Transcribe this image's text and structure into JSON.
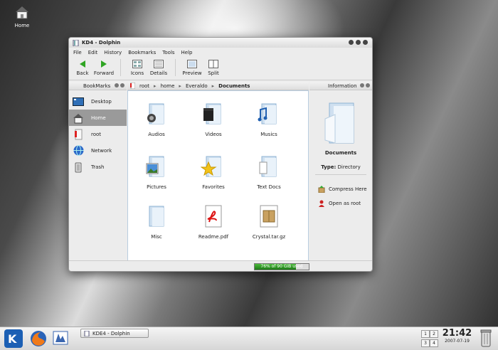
{
  "desktop": {
    "home_label": "Home"
  },
  "window": {
    "title": "KD4 - Dolphin",
    "menu": [
      "File",
      "Edit",
      "History",
      "Bookmarks",
      "Tools",
      "Help"
    ],
    "toolbar": {
      "back": "Back",
      "forward": "Forward",
      "icons": "Icons",
      "details": "Details",
      "preview": "Preview",
      "split": "Split"
    },
    "bookmarks": {
      "title": "BookMarks",
      "items": [
        {
          "label": "Desktop",
          "icon": "desktop-icon"
        },
        {
          "label": "Home",
          "icon": "home-icon",
          "selected": true
        },
        {
          "label": "root",
          "icon": "root-icon"
        },
        {
          "label": "Network",
          "icon": "network-icon"
        },
        {
          "label": "Trash",
          "icon": "trash-icon"
        }
      ]
    },
    "breadcrumb": [
      "root",
      "home",
      "Everaldo",
      "Documents"
    ],
    "files": [
      {
        "name": "Audios",
        "icon": "folder-audio-icon"
      },
      {
        "name": "Videos",
        "icon": "folder-video-icon"
      },
      {
        "name": "Musics",
        "icon": "folder-music-icon"
      },
      {
        "name": "Pictures",
        "icon": "folder-pictures-icon"
      },
      {
        "name": "Favorites",
        "icon": "folder-favorites-icon"
      },
      {
        "name": "Text Docs",
        "icon": "folder-text-icon"
      },
      {
        "name": "Misc",
        "icon": "folder-icon"
      },
      {
        "name": "Readme.pdf",
        "icon": "pdf-icon"
      },
      {
        "name": "Crystal.tar.gz",
        "icon": "archive-icon"
      }
    ],
    "information": {
      "title": "Information",
      "name": "Documents",
      "type_label": "Type:",
      "type_value": "Directory",
      "actions": [
        "Compress Here",
        "Open as root"
      ]
    },
    "status": {
      "disk_label": "76% of 90 GiB used",
      "disk_fraction": 0.76
    }
  },
  "taskbar": {
    "task_label": "KDE4 - Dolphin",
    "pager": [
      "1",
      "2",
      "3",
      "4"
    ],
    "time": "21:42",
    "date": "2007-07-19"
  },
  "colors": {
    "accent": "#1e7a18",
    "selection": "#9a9a9a",
    "folder": "#b9d3ea"
  }
}
